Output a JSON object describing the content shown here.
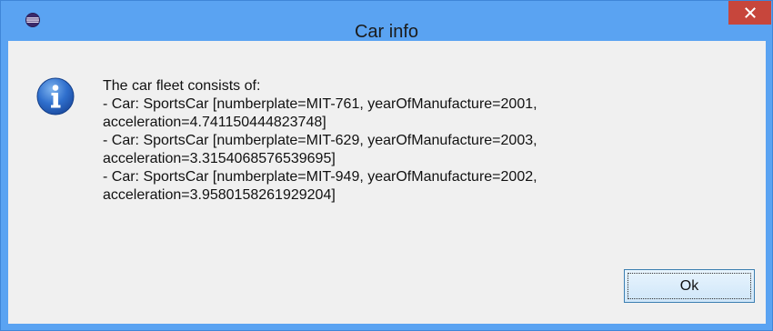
{
  "window": {
    "title": "Car info",
    "app_icon": "eclipse-icon",
    "close_icon": "close-icon",
    "colors": {
      "titlebar": "#5aa3f2",
      "close_button": "#c7463c",
      "client": "#f0f0f0"
    }
  },
  "dialog": {
    "icon": "info-icon",
    "message_lines": [
      "The car fleet consists of:",
      "- Car: SportsCar [numberplate=MIT-761, yearOfManufacture=2001,",
      "acceleration=4.741150444823748]",
      "- Car: SportsCar [numberplate=MIT-629, yearOfManufacture=2003,",
      "acceleration=3.3154068576539695]",
      "- Car: SportsCar [numberplate=MIT-949, yearOfManufacture=2002,",
      "acceleration=3.9580158261929204]"
    ],
    "ok_label": "Ok"
  }
}
